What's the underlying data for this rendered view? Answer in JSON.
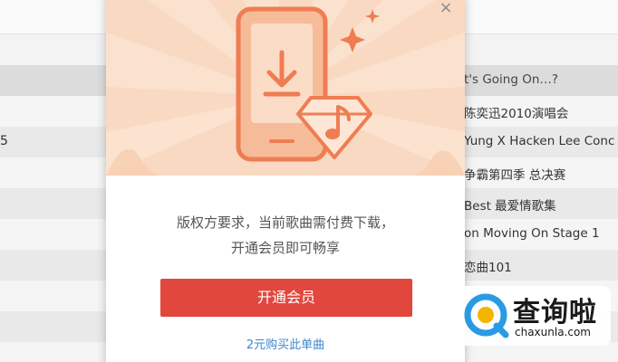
{
  "song_list": {
    "header_title": "t's Going On…?",
    "rows": [
      "陈奕迅2010演唱会",
      "Yung X Hacken Lee Conc",
      "争霸第四季 总决赛",
      "Best 最爱情歌集",
      "on Moving On Stage 1",
      "恋曲101"
    ],
    "left_fragment": "5"
  },
  "modal": {
    "close_symbol": "×",
    "message_line1": "版权方要求，当前歌曲需付费下载，",
    "message_line2": "开通会员即可畅享",
    "vip_button": "开通会员",
    "buy_single_link": "2元购买此单曲"
  },
  "watermark": {
    "title": "查询啦",
    "domain": "chaxunla.com"
  },
  "colors": {
    "banner_bg": "#f9d9c2",
    "accent_orange": "#f08a5d",
    "vip_button": "#e2473e",
    "link_blue": "#3f85c8",
    "watermark_blue": "#2a9be3"
  },
  "icons": {
    "phone": "phone-download-icon",
    "diamond": "diamond-music-icon",
    "sparkle": "sparkle-icon"
  }
}
